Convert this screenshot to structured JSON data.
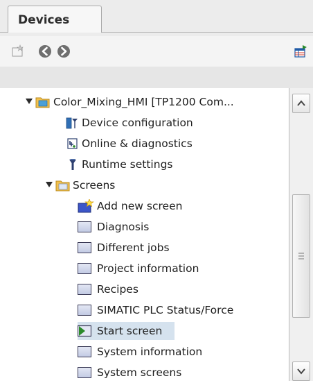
{
  "tab": {
    "title": "Devices"
  },
  "toolbar": {
    "icons": [
      "new-item-icon",
      "back-icon",
      "forward-icon",
      "table-view-icon"
    ]
  },
  "tree": {
    "root": {
      "label": "Color_Mixing_HMI [TP1200 Com..."
    },
    "device_configuration": {
      "label": "Device configuration"
    },
    "online_diagnostics": {
      "label": "Online & diagnostics"
    },
    "runtime_settings": {
      "label": "Runtime settings"
    },
    "screens": {
      "label": "Screens",
      "add_new": "Add new screen",
      "items": [
        {
          "label": "Diagnosis"
        },
        {
          "label": "Different jobs"
        },
        {
          "label": "Project information"
        },
        {
          "label": "Recipes"
        },
        {
          "label": "SIMATIC PLC Status/Force"
        },
        {
          "label": "Start screen",
          "selected": true
        },
        {
          "label": "System information"
        },
        {
          "label": "System screens"
        }
      ]
    }
  },
  "colors": {
    "selection": "#d5e2ee",
    "folder": "#f2c14e",
    "accent": "#2a8a2a"
  }
}
